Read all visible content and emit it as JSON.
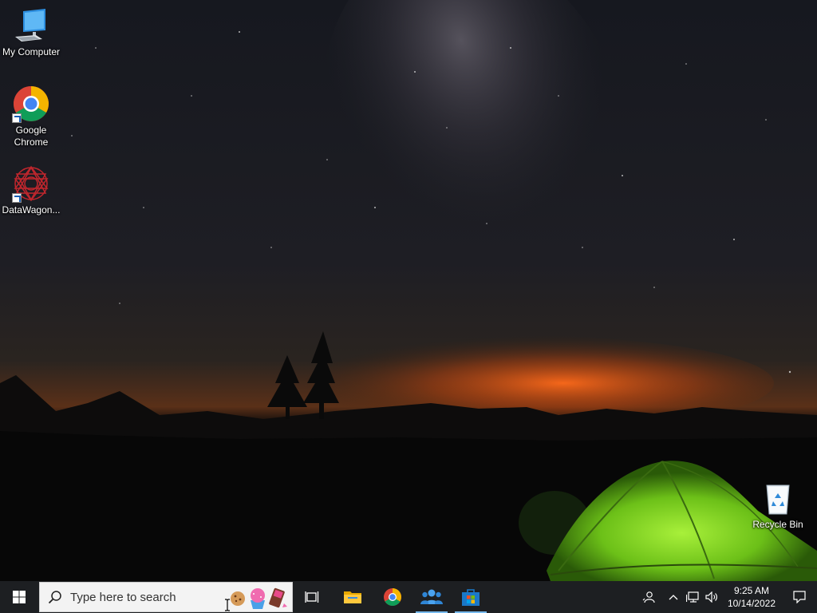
{
  "desktop": {
    "icons": [
      {
        "label": "My Computer",
        "icon": "monitor-icon"
      },
      {
        "label": "Google Chrome",
        "icon": "chrome-icon",
        "shortcut": true
      },
      {
        "label": "DataWagon...",
        "icon": "datawagon-icon",
        "shortcut": true
      }
    ],
    "recycle_bin": {
      "label": "Recycle Bin",
      "icon": "recycle-bin-icon"
    }
  },
  "taskbar": {
    "search_placeholder": "Type here to search",
    "pinned": [
      {
        "name": "task-view",
        "icon": "task-view-icon"
      },
      {
        "name": "file-explorer",
        "icon": "folder-icon"
      },
      {
        "name": "chrome",
        "icon": "chrome-icon"
      },
      {
        "name": "people",
        "icon": "people-icon",
        "active": true
      },
      {
        "name": "microsoft-store",
        "icon": "store-icon",
        "active": true
      }
    ],
    "tray": {
      "time": "9:25 AM",
      "date": "10/14/2022"
    }
  },
  "colors": {
    "taskbar_bg": "#1d1f22",
    "active_indicator": "#76b9ed",
    "tent_green": "#7cd321"
  }
}
